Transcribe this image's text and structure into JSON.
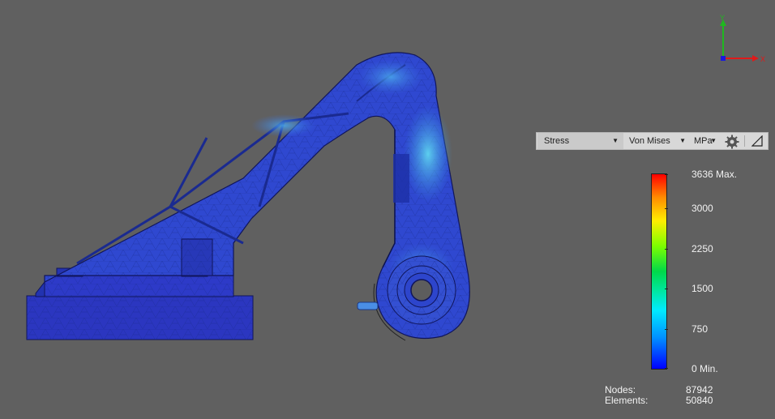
{
  "triad": {
    "y_label": "Y",
    "x_label": "X"
  },
  "toolbar": {
    "result_type": "Stress",
    "component": "Von Mises",
    "unit": "MPa",
    "settings_icon": "gear-icon",
    "resize_icon": "corner-resize-icon"
  },
  "legend": {
    "max_label": "3636 Max.",
    "min_label": "0 Min.",
    "ticks": [
      "3000",
      "2250",
      "1500",
      "750"
    ],
    "gradient_colors": [
      "#ff0000",
      "#ff8c00",
      "#ffee00",
      "#7cff00",
      "#00d84a",
      "#00e6a0",
      "#00eaff",
      "#0090ff",
      "#0000ff"
    ]
  },
  "stats": {
    "nodes_label": "Nodes:",
    "nodes_value": "87942",
    "elements_label": "Elements:",
    "elements_value": "50840"
  },
  "colors": {
    "background": "#606060",
    "model_low_stress": "#2a3dc6",
    "model_mid_stress": "#3fa7e8"
  }
}
